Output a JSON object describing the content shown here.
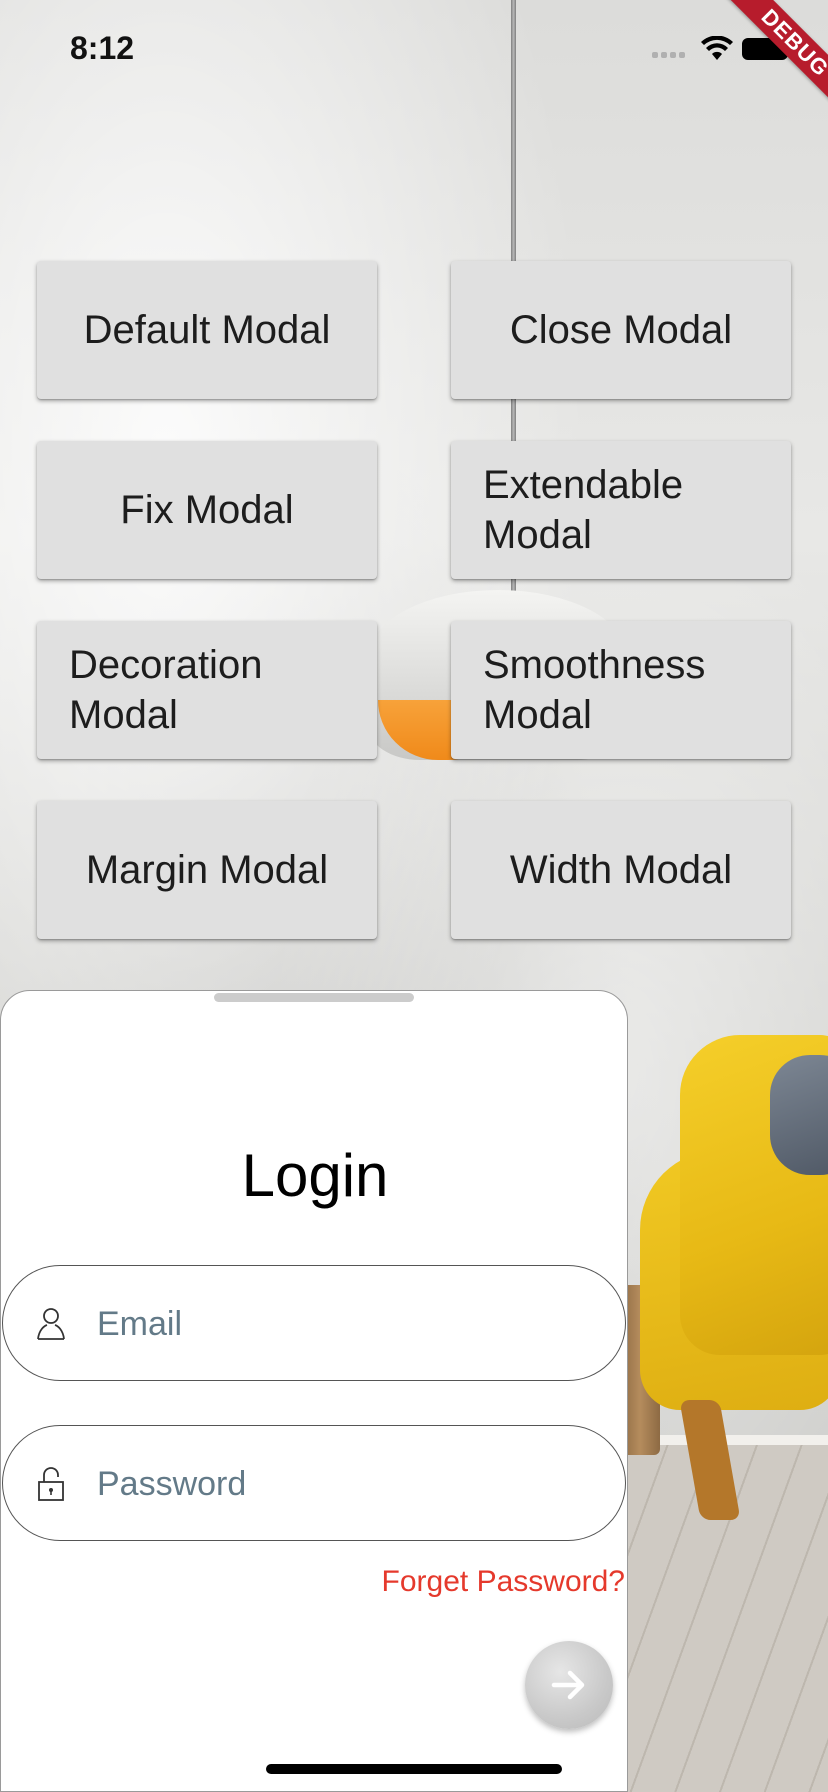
{
  "status_bar": {
    "time": "8:12"
  },
  "debug_banner": "DEBUG",
  "buttons": [
    {
      "label": "Default Modal"
    },
    {
      "label": "Close Modal"
    },
    {
      "label": "Fix Modal"
    },
    {
      "label": "Extendable Modal"
    },
    {
      "label": "Decoration Modal"
    },
    {
      "label": "Smoothness Modal"
    },
    {
      "label": "Margin Modal"
    },
    {
      "label": "Width Modal"
    }
  ],
  "login": {
    "title": "Login",
    "email_placeholder": "Email",
    "password_placeholder": "Password",
    "forget_password": "Forget Password?",
    "link_color": "#e5392c"
  },
  "icons": {
    "email": "user-icon",
    "password": "lock-icon",
    "submit": "arrow-right-icon"
  }
}
